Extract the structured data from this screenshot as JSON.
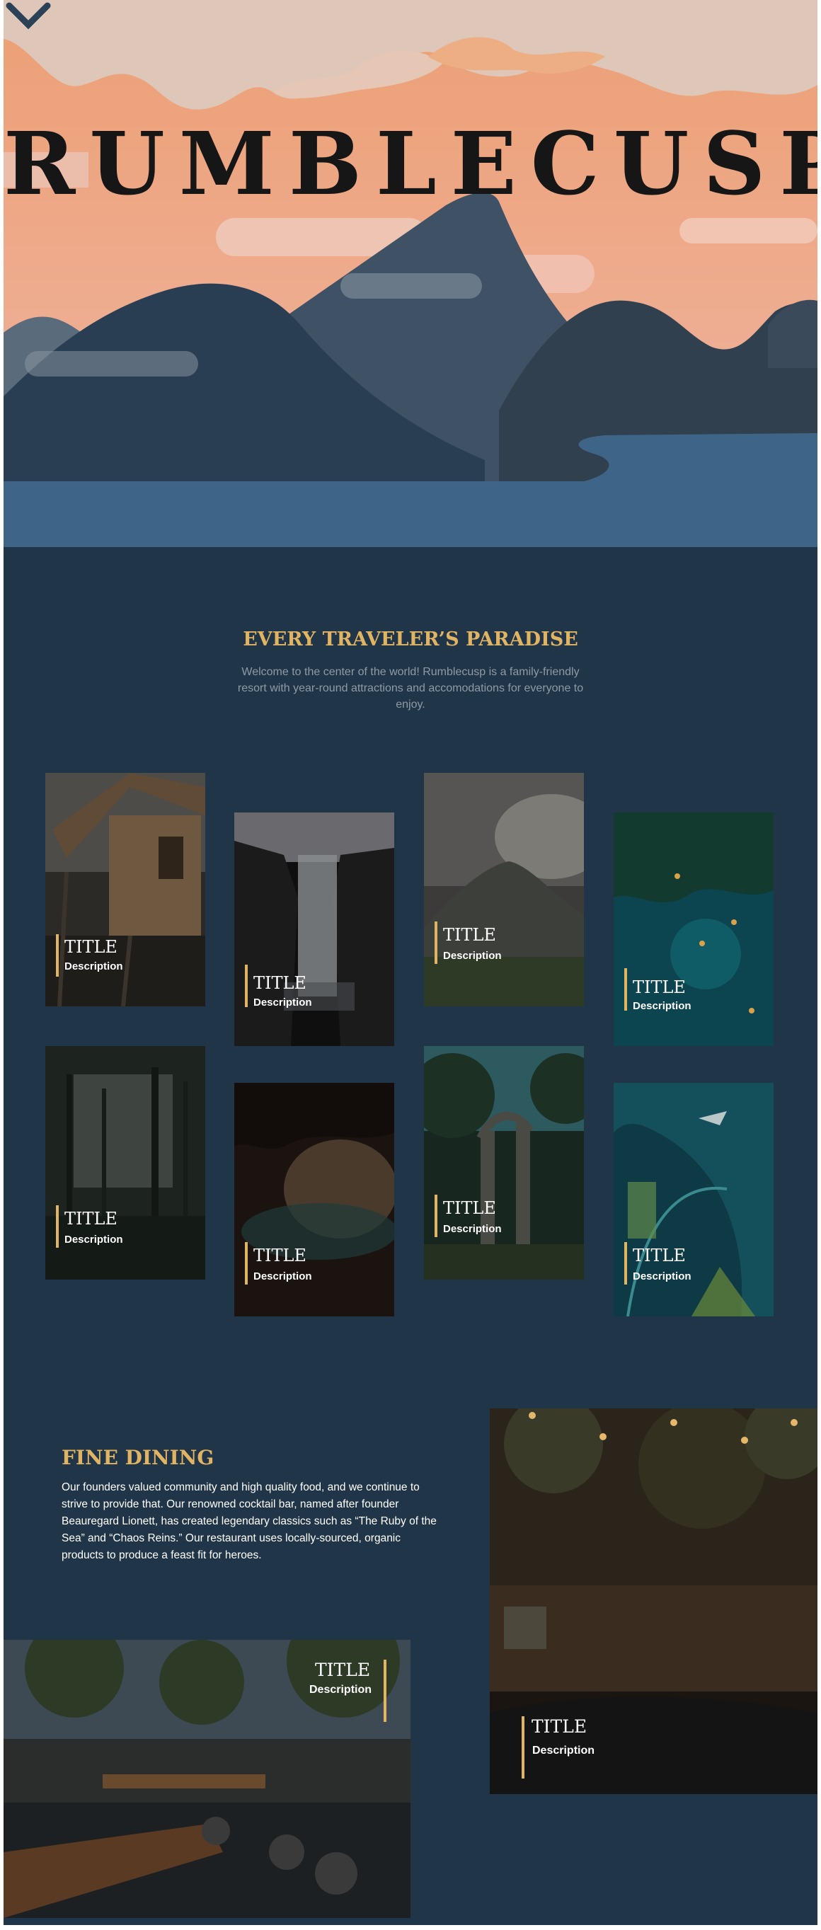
{
  "hero": {
    "title": "RUMBLECUSP",
    "scroll_icon": "chevron-down-icon"
  },
  "intro": {
    "heading": "EVERY TRAVELER’S PARADISE",
    "text": "Welcome to the center of the world! Rumblecusp is a family-friendly resort with year-round attractions and accomodations for everyone to enjoy."
  },
  "gallery": {
    "cards": [
      {
        "title": "TITLE",
        "description": "Description"
      },
      {
        "title": "TITLE",
        "description": "Description"
      },
      {
        "title": "TITLE",
        "description": "Description"
      },
      {
        "title": "TITLE",
        "description": "Description"
      },
      {
        "title": "TITLE",
        "description": "Description"
      },
      {
        "title": "TITLE",
        "description": "Description"
      },
      {
        "title": "TITLE",
        "description": "Description"
      },
      {
        "title": "TITLE",
        "description": "Description"
      }
    ]
  },
  "dining": {
    "heading": "FINE DINING",
    "text": "Our founders valued community and high quality food, and we continue to strive to provide that. Our renowned cocktail bar, named after founder Beauregard Lionett, has created legendary classics such as “The Ruby of the Sea” and “Chaos Reins.” Our restaurant uses locally-sourced, organic products to produce a feast fit for heroes.",
    "photos": [
      {
        "title": "TITLE",
        "description": "Description"
      },
      {
        "title": "TITLE",
        "description": "Description"
      }
    ]
  },
  "colors": {
    "background": "#213548",
    "accent": "#e0b463",
    "sky": "#edb08a",
    "water": "#3e6588"
  }
}
